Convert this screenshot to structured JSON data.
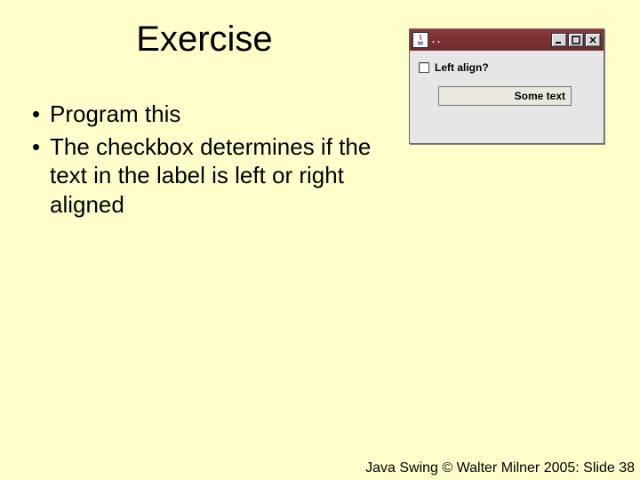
{
  "title": "Exercise",
  "bullets": [
    "Program this",
    "The checkbox determines if the text in the label is left or right aligned"
  ],
  "window": {
    "title": ". .",
    "checkbox_label": "Left align?",
    "label_text": "Some text"
  },
  "footer": "Java Swing © Walter Milner 2005: Slide 38"
}
